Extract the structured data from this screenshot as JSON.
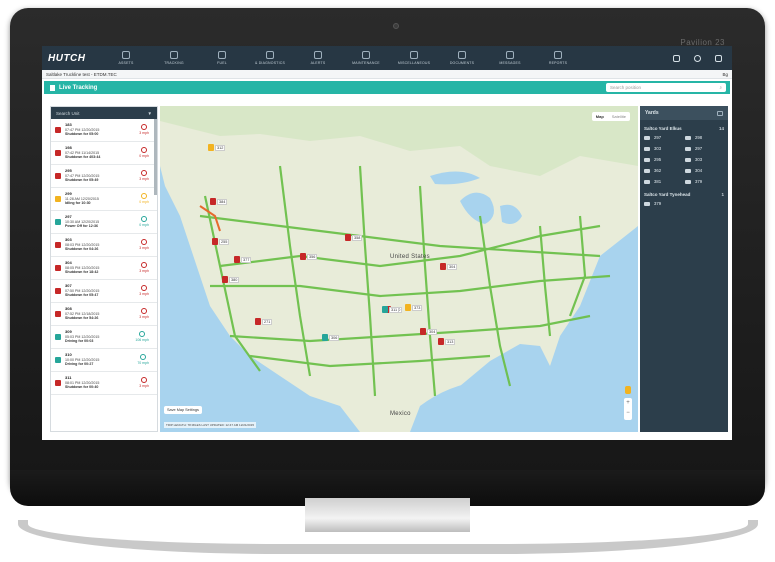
{
  "device": {
    "brand": "Pavilion 23"
  },
  "nav": {
    "logo": "HUTCH",
    "items": [
      {
        "label": "ASSETS"
      },
      {
        "label": "TRACKING"
      },
      {
        "label": "FUEL"
      },
      {
        "label": "& DIAGNOSTICS"
      },
      {
        "label": "ALERTS"
      },
      {
        "label": "MAINTENANCE"
      },
      {
        "label": "MISCELLANEOUS"
      },
      {
        "label": "DOCUMENTS"
      },
      {
        "label": "MESSAGES"
      },
      {
        "label": "REPORTS"
      }
    ]
  },
  "subbar": {
    "left": "Saltlake Truckline test - ETDM.TEC",
    "right": "Bg"
  },
  "live": {
    "title": "Live Tracking",
    "search_placeholder": "Search position"
  },
  "units": {
    "search_label": "Search Unit",
    "rows": [
      {
        "id": "183",
        "time": "07:47 PM 12/20/2015",
        "status": "Shutdown for 05:00",
        "badge": "3 mph",
        "color": "#c62828"
      },
      {
        "id": "198",
        "time": "07:42 PM 11/14/2015",
        "status": "Shutdown for 403:44",
        "badge": "0 mph",
        "color": "#c62828"
      },
      {
        "id": "295",
        "time": "07:47 PM 12/20/2015",
        "status": "Shutdown for 05:49",
        "badge": "3 mph",
        "color": "#c62828"
      },
      {
        "id": "299",
        "time": "11:28 AM 12/20/2015",
        "status": "Idling for 10:30",
        "badge": "0 mph",
        "color": "#f2b320"
      },
      {
        "id": "297",
        "time": "10:30 AM 12/20/2015",
        "status": "Power Off for 12:36",
        "badge": "0 mph",
        "color": "#26a69a"
      },
      {
        "id": "303",
        "time": "08:03 PM 12/20/2015",
        "status": "Shutdown for 04:26",
        "badge": "3 mph",
        "color": "#c62828"
      },
      {
        "id": "304",
        "time": "08:05 PM 12/20/2015",
        "status": "Shutdown for 18:42",
        "badge": "3 mph",
        "color": "#c62828"
      },
      {
        "id": "307",
        "time": "07:50 PM 12/20/2015",
        "status": "Shutdown for 05:47",
        "badge": "3 mph",
        "color": "#c62828"
      },
      {
        "id": "308",
        "time": "07:52 PM 12/18/2015",
        "status": "Shutdown for 54:26",
        "badge": "3 mph",
        "color": "#c62828"
      },
      {
        "id": "309",
        "time": "05:03 PM 12/20/2015",
        "status": "Driving for 00:03",
        "badge": "106 mph",
        "color": "#26a69a"
      },
      {
        "id": "310",
        "time": "10:00 PM 12/20/2015",
        "status": "Driving for 00:27",
        "badge": "70 mph",
        "color": "#26a69a"
      },
      {
        "id": "311",
        "time": "08:01 PM 12/20/2015",
        "status": "Shutdown for 00:40",
        "badge": "3 mph",
        "color": "#c62828"
      }
    ]
  },
  "map": {
    "toggle_map": "Map",
    "toggle_satellite": "Satellite",
    "country_us": "United States",
    "country_mx": "Mexico",
    "settings": "Save Map Settings",
    "footer": "TRIP LENGTH: 78 MILES    LAST UPDATED: 12:47 AM 12/21/2015",
    "markers": [
      {
        "id": "312",
        "color": "#f2b320"
      },
      {
        "id": "384",
        "color": "#c62828"
      },
      {
        "id": "255",
        "color": "#c62828"
      },
      {
        "id": "377",
        "color": "#c62828"
      },
      {
        "id": "380",
        "color": "#c62828"
      },
      {
        "id": "358",
        "color": "#c62828"
      },
      {
        "id": "356",
        "color": "#c62828"
      },
      {
        "id": "304",
        "color": "#c62828"
      },
      {
        "id": "310",
        "color": "#c62828"
      },
      {
        "id": "311",
        "color": "#26a69a"
      },
      {
        "id": "373",
        "color": "#f2b320"
      },
      {
        "id": "271",
        "color": "#c62828"
      },
      {
        "id": "306",
        "color": "#26a69a"
      },
      {
        "id": "304",
        "color": "#c62828"
      },
      {
        "id": "313",
        "color": "#c62828"
      }
    ]
  },
  "yards": {
    "title": "Yards",
    "groups": [
      {
        "name": "Saltco Yard Elkus",
        "count": "14",
        "units": [
          "297",
          "298",
          "303",
          "297",
          "295",
          "303",
          "362",
          "304",
          "381",
          "379"
        ]
      },
      {
        "name": "Saltco Yard Tynehead",
        "count": "1",
        "units": [
          "379"
        ]
      }
    ]
  }
}
